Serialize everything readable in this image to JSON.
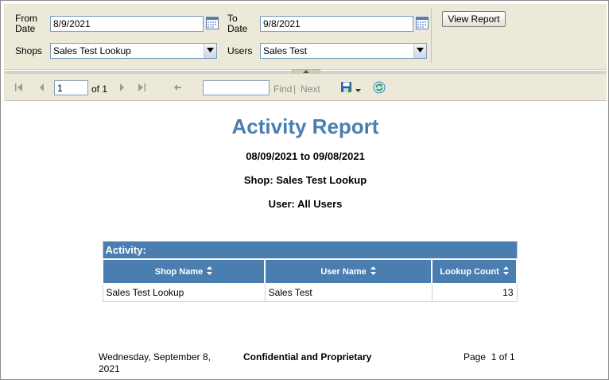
{
  "params": {
    "from_date_label": "From\nDate",
    "from_date_value": "8/9/2021",
    "to_date_label": "To\nDate",
    "to_date_value": "9/8/2021",
    "shops_label": "Shops",
    "shops_value": "Sales Test Lookup",
    "users_label": "Users",
    "users_value": "Sales Test",
    "view_report_label": "View Report"
  },
  "toolbar": {
    "page_number": "1",
    "of_pages": "of 1",
    "find_label": "Find",
    "separator": "|",
    "next_label": "Next"
  },
  "report": {
    "title": "Activity Report",
    "date_range": "08/09/2021 to 09/08/2021",
    "shop_line": "Shop: Sales Test Lookup",
    "user_line": "User: All Users",
    "table": {
      "caption": "Activity:",
      "headers": [
        "Shop Name",
        "User Name",
        "Lookup Count"
      ],
      "rows": [
        [
          "Sales Test Lookup",
          "Sales Test",
          "13"
        ]
      ]
    },
    "footer": {
      "date": "Wednesday, September 8, 2021",
      "confidential": "Confidential and Proprietary",
      "page": "Page  1 of 1"
    }
  },
  "colors": {
    "accent": "#4a7eb0",
    "param_background": "#ece9d8"
  }
}
